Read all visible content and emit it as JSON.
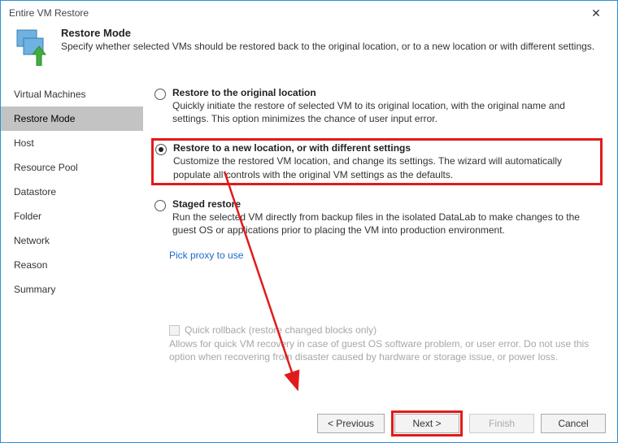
{
  "window": {
    "title": "Entire VM Restore"
  },
  "header": {
    "title": "Restore Mode",
    "subtitle": "Specify whether selected VMs should be restored back to the original location, or to a new location or with different settings."
  },
  "sidebar": {
    "items": [
      {
        "label": "Virtual Machines",
        "selected": false
      },
      {
        "label": "Restore Mode",
        "selected": true
      },
      {
        "label": "Host",
        "selected": false
      },
      {
        "label": "Resource Pool",
        "selected": false
      },
      {
        "label": "Datastore",
        "selected": false
      },
      {
        "label": "Folder",
        "selected": false
      },
      {
        "label": "Network",
        "selected": false
      },
      {
        "label": "Reason",
        "selected": false
      },
      {
        "label": "Summary",
        "selected": false
      }
    ]
  },
  "options": {
    "original": {
      "title": "Restore to the original location",
      "desc": "Quickly initiate the restore of selected VM to its original location, with the original name and settings. This option minimizes the chance of user input error."
    },
    "newloc": {
      "title": "Restore to a new location, or with different settings",
      "desc": "Customize the restored VM location, and change its settings. The wizard will automatically populate all controls with the original VM settings as the defaults."
    },
    "staged": {
      "title": "Staged restore",
      "desc": "Run the selected VM directly from backup files in the isolated DataLab to make changes to the guest OS or applications prior to placing the VM into production environment."
    },
    "proxy_link": "Pick proxy to use"
  },
  "quick": {
    "label": "Quick rollback (restore changed blocks only)",
    "desc": "Allows for quick VM recovery in case of guest OS software problem, or user error. Do not use this option when recovering from disaster caused by hardware or storage issue, or power loss."
  },
  "buttons": {
    "previous": "< Previous",
    "next": "Next >",
    "finish": "Finish",
    "cancel": "Cancel"
  }
}
